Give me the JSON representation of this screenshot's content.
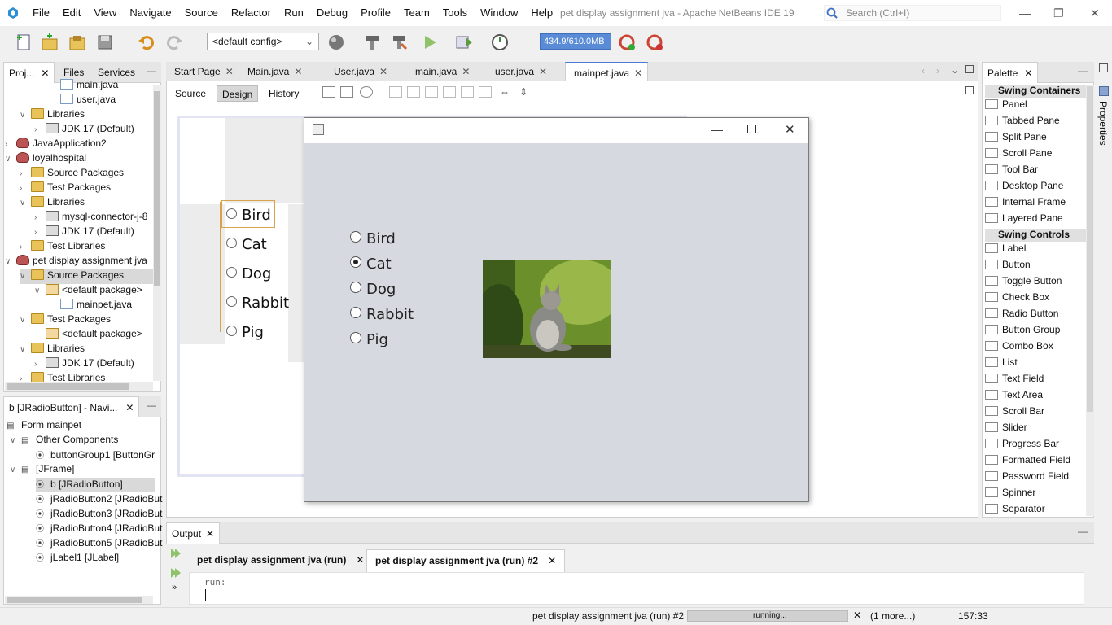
{
  "window": {
    "title": "pet display assignment jva - Apache NetBeans IDE 19",
    "menus": [
      "File",
      "Edit",
      "View",
      "Navigate",
      "Source",
      "Refactor",
      "Run",
      "Debug",
      "Profile",
      "Team",
      "Tools",
      "Window",
      "Help"
    ],
    "search_placeholder": "Search (Ctrl+I)"
  },
  "toolbar": {
    "config": "<default config>",
    "memory": "434.9/610.0MB"
  },
  "projects_panel": {
    "tabs": [
      "Proj...",
      "Files",
      "Services"
    ],
    "tree": [
      {
        "label": "main.java",
        "icon": "java-file-icon",
        "level": 4
      },
      {
        "label": "user.java",
        "icon": "java-file-icon",
        "level": 4
      },
      {
        "label": "Libraries",
        "icon": "library-folder-icon",
        "level": 2,
        "arrow": "down"
      },
      {
        "label": "JDK 17 (Default)",
        "icon": "jdk-icon",
        "level": 3,
        "arrow": "right"
      },
      {
        "label": "JavaApplication2",
        "icon": "project-icon",
        "level": 1,
        "arrow": "right"
      },
      {
        "label": "loyalhospital",
        "icon": "project-icon",
        "level": 1,
        "arrow": "down"
      },
      {
        "label": "Source Packages",
        "icon": "package-folder-icon",
        "level": 2,
        "arrow": "right"
      },
      {
        "label": "Test Packages",
        "icon": "package-folder-icon",
        "level": 2,
        "arrow": "right"
      },
      {
        "label": "Libraries",
        "icon": "library-folder-icon",
        "level": 2,
        "arrow": "down"
      },
      {
        "label": "mysql-connector-j-8",
        "icon": "jar-icon",
        "level": 3,
        "arrow": "right"
      },
      {
        "label": "JDK 17 (Default)",
        "icon": "jdk-icon",
        "level": 3,
        "arrow": "right"
      },
      {
        "label": "Test Libraries",
        "icon": "library-folder-icon",
        "level": 2,
        "arrow": "right"
      },
      {
        "label": "pet display assignment jva",
        "icon": "project-icon",
        "level": 1,
        "arrow": "down"
      },
      {
        "label": "Source Packages",
        "icon": "package-folder-icon",
        "level": 2,
        "arrow": "down",
        "selected": true
      },
      {
        "label": "<default package>",
        "icon": "package-icon",
        "level": 3,
        "arrow": "down"
      },
      {
        "label": "mainpet.java",
        "icon": "java-file-icon",
        "level": 4
      },
      {
        "label": "Test Packages",
        "icon": "package-folder-icon",
        "level": 2,
        "arrow": "down"
      },
      {
        "label": "<default package>",
        "icon": "package-icon",
        "level": 3
      },
      {
        "label": "Libraries",
        "icon": "library-folder-icon",
        "level": 2,
        "arrow": "down"
      },
      {
        "label": "JDK 17 (Default)",
        "icon": "jdk-icon",
        "level": 3,
        "arrow": "right"
      },
      {
        "label": "Test Libraries",
        "icon": "library-folder-icon",
        "level": 2,
        "arrow": "right"
      }
    ]
  },
  "navigator_panel": {
    "title": "b [JRadioButton] - Navi...",
    "tree": [
      {
        "label": "Form mainpet",
        "level": 0
      },
      {
        "label": "Other Components",
        "level": 1,
        "arrow": "down"
      },
      {
        "label": "buttonGroup1 [ButtonGr",
        "level": 2
      },
      {
        "label": "[JFrame]",
        "level": 1,
        "arrow": "down"
      },
      {
        "label": "b [JRadioButton]",
        "level": 2,
        "selected": true
      },
      {
        "label": "jRadioButton2 [JRadioBut",
        "level": 2
      },
      {
        "label": "jRadioButton3 [JRadioBut",
        "level": 2
      },
      {
        "label": "jRadioButton4 [JRadioBut",
        "level": 2
      },
      {
        "label": "jRadioButton5 [JRadioBut",
        "level": 2
      },
      {
        "label": "jLabel1 [JLabel]",
        "level": 2
      }
    ]
  },
  "editor": {
    "tabs": [
      "Start Page",
      "Main.java",
      "User.java",
      "main.java",
      "user.java",
      "mainpet.java"
    ],
    "active_tab": "mainpet.java",
    "subtabs": [
      "Source",
      "Design",
      "History"
    ],
    "active_subtab": "Design",
    "design_radios": [
      "Bird",
      "Cat",
      "Dog",
      "Rabbit",
      "Pig"
    ]
  },
  "running_frame": {
    "options": [
      "Bird",
      "Cat",
      "Dog",
      "Rabbit",
      "Pig"
    ],
    "selected": "Cat",
    "image_icon": "cat-photo"
  },
  "palette": {
    "title": "Palette",
    "side_label": "Properties",
    "sections": [
      {
        "name": "Swing Containers",
        "items": [
          "Panel",
          "Tabbed Pane",
          "Split Pane",
          "Scroll Pane",
          "Tool Bar",
          "Desktop Pane",
          "Internal Frame",
          "Layered Pane"
        ]
      },
      {
        "name": "Swing Controls",
        "items": [
          "Label",
          "Button",
          "Toggle Button",
          "Check Box",
          "Radio Button",
          "Button Group",
          "Combo Box",
          "List",
          "Text Field",
          "Text Area",
          "Scroll Bar",
          "Slider",
          "Progress Bar",
          "Formatted Field",
          "Password Field",
          "Spinner",
          "Separator"
        ]
      }
    ]
  },
  "output": {
    "title": "Output",
    "tabs": [
      "pet display assignment jva (run)",
      "pet display assignment jva (run) #2"
    ],
    "active_tab": "pet display assignment jva (run) #2",
    "text": "run:"
  },
  "status": {
    "task": "pet display assignment jva (run) #2",
    "progress_text": "running...",
    "more": "(1 more...)",
    "position": "157:33"
  }
}
